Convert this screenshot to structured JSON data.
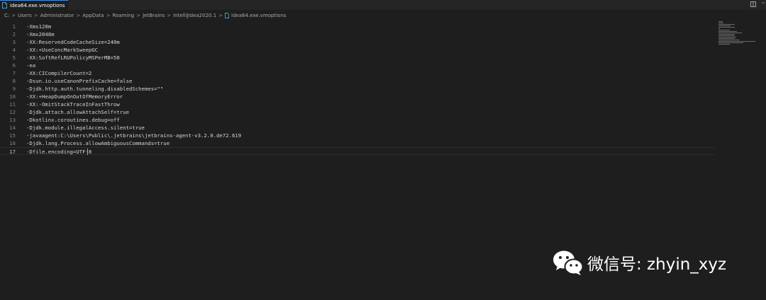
{
  "tab": {
    "label": "idea64.exe.vmoptions",
    "close_glyph": "×",
    "icon": "file-icon"
  },
  "toolbar": {
    "split_icon": "split-editor-icon",
    "more_glyph": "···"
  },
  "breadcrumb": {
    "items": [
      "C:",
      "Users",
      "Administrator",
      "AppData",
      "Roaming",
      "JetBrains",
      "IntelliJIdea2020.1",
      "idea64.exe.vmoptions"
    ],
    "separator": ">"
  },
  "editor": {
    "active_line": 17,
    "lines": [
      {
        "n": "1",
        "text": "-Xms128m"
      },
      {
        "n": "2",
        "text": "-Xmx2048m"
      },
      {
        "n": "3",
        "text": "-XX:ReservedCodeCacheSize=240m"
      },
      {
        "n": "4",
        "text": "-XX:+UseConcMarkSweepGC"
      },
      {
        "n": "5",
        "text": "-XX:SoftRefLRUPolicyMSPerMB=50"
      },
      {
        "n": "6",
        "text": "-ea"
      },
      {
        "n": "7",
        "text": "-XX:CICompilerCount=2"
      },
      {
        "n": "8",
        "text": "-Dsun.io.useCanonPrefixCache=false"
      },
      {
        "n": "9",
        "text": "-Djdk.http.auth.tunneling.disabledSchemes=\"\""
      },
      {
        "n": "10",
        "text": "-XX:+HeapDumpOnOutOfMemoryError"
      },
      {
        "n": "11",
        "text": "-XX:-OmitStackTraceInFastThrow"
      },
      {
        "n": "12",
        "text": "-Djdk.attach.allowAttachSelf=true"
      },
      {
        "n": "13",
        "text": "-Dkotlinx.coroutines.debug=off"
      },
      {
        "n": "14",
        "text": "-Djdk.module.illegalAccess.silent=true"
      },
      {
        "n": "15",
        "text": "-javaagent:C:\\Users\\Public\\.jetbrains\\jetbrains-agent-v3.2.0.de72.619"
      },
      {
        "n": "16",
        "text": "-Djdk.lang.Process.allowAmbiguousCommands=true"
      },
      {
        "n": "17",
        "text": "-Dfile.encoding=UTF-8"
      }
    ]
  },
  "watermark": {
    "text": "微信号: zhyin_xyz",
    "icon": "wechat-icon"
  },
  "colors": {
    "background": "#1e1e1e",
    "tab_accent": "#3b8eea",
    "file_icon": "#519aba"
  }
}
